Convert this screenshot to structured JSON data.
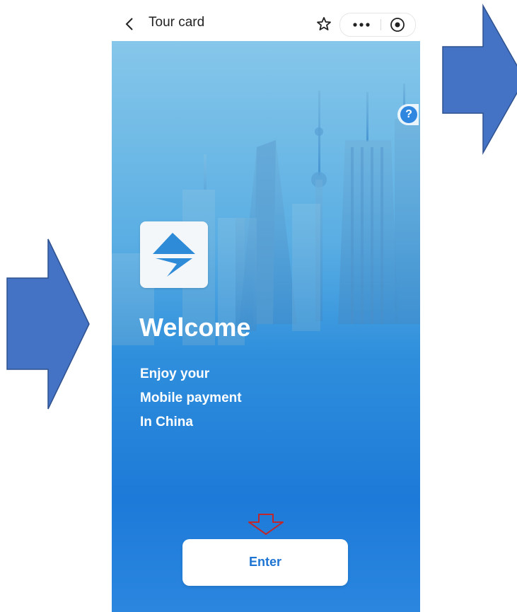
{
  "navbar": {
    "title": "Tour card",
    "icons": [
      "back-arrow-icon",
      "star-icon",
      "more-dots-icon",
      "target-circle-icon"
    ]
  },
  "main": {
    "help_label": "?",
    "logo": "tour-card-logo",
    "welcome": "Welcome",
    "subtitle_lines": [
      "Enjoy your",
      "Mobile payment",
      "In China"
    ],
    "enter_label": "Enter"
  },
  "annotations": {
    "arrow_color": "#4472c4",
    "pointer_color": "#c0272d"
  },
  "colors": {
    "screen_top": "#86c7ea",
    "screen_bottom": "#1d7ad8",
    "button_text": "#1e74d2"
  }
}
